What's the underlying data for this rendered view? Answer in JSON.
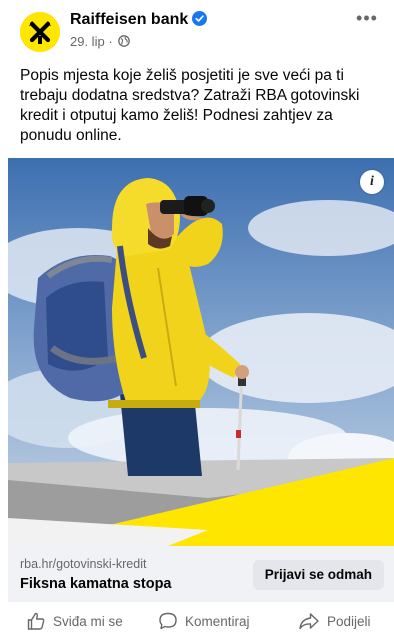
{
  "post": {
    "page_name": "Raiffeisen bank",
    "verified_icon": "verified-badge-icon",
    "date": "29. lip",
    "separator": "·",
    "audience_icon": "globe-icon",
    "more_label": "•••",
    "text": "Popis mjesta koje želiš posjetiti je sve veći pa ti trebaju dodatna sredstva? Zatraži RBA gotovinski kredit i otputuj kamo želiš! Podnesi zahtjev za ponudu online."
  },
  "ad": {
    "info_label": "i",
    "url": "rba.hr/gotovinski-kredit",
    "headline": "Fiksna kamatna stopa",
    "cta_label": "Prijavi se odmah"
  },
  "actions": {
    "like_label": "Sviđa mi se",
    "comment_label": "Komentiraj",
    "share_label": "Podijeli"
  },
  "colors": {
    "brand_yellow": "#ffe600",
    "verified_blue": "#1877f2",
    "secondary_text": "#65676b"
  }
}
